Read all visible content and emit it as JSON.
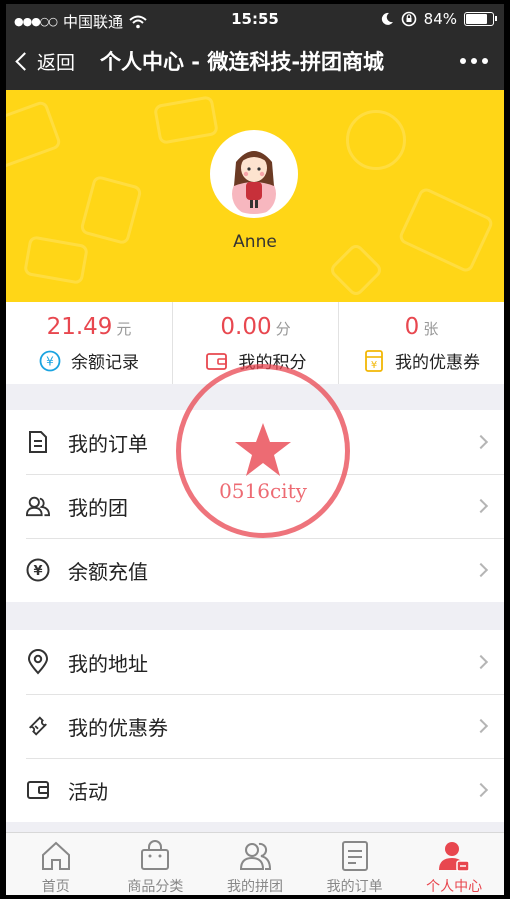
{
  "statusbar": {
    "carrier": "中国联通",
    "time": "15:55",
    "battery_text": "84%",
    "battery_level": 0.84
  },
  "navbar": {
    "back_label": "返回",
    "title": "个人中心 - 微连科技-拼团商城"
  },
  "profile": {
    "username": "Anne",
    "accent": "#ffd617"
  },
  "stats": [
    {
      "value": "21.49",
      "unit": "元",
      "label": "余额记录",
      "icon": "yen-circle-icon"
    },
    {
      "value": "0.00",
      "unit": "分",
      "label": "我的积分",
      "icon": "wallet-icon"
    },
    {
      "value": "0",
      "unit": "张",
      "label": "我的优惠券",
      "icon": "coupon-icon"
    }
  ],
  "menu_group_1": [
    {
      "label": "我的订单",
      "icon": "order-doc-icon"
    },
    {
      "label": "我的团",
      "icon": "group-icon"
    },
    {
      "label": "余额充值",
      "icon": "yen-circle-icon"
    }
  ],
  "menu_group_2": [
    {
      "label": "我的地址",
      "icon": "location-pin-icon"
    },
    {
      "label": "我的优惠券",
      "icon": "ticket-icon"
    },
    {
      "label": "活动",
      "icon": "wallet-icon"
    }
  ],
  "stamp": {
    "text": "0516city"
  },
  "tabbar": [
    {
      "label": "首页",
      "icon": "home-icon",
      "active": false
    },
    {
      "label": "商品分类",
      "icon": "bag-icon",
      "active": false
    },
    {
      "label": "我的拼团",
      "icon": "group-icon",
      "active": false
    },
    {
      "label": "我的订单",
      "icon": "order-doc-icon",
      "active": false
    },
    {
      "label": "个人中心",
      "icon": "user-icon",
      "active": true
    }
  ],
  "colors": {
    "accent_red": "#e8474f",
    "yen_blue": "#1aa3e0",
    "coupon_yellow": "#f2b705"
  }
}
